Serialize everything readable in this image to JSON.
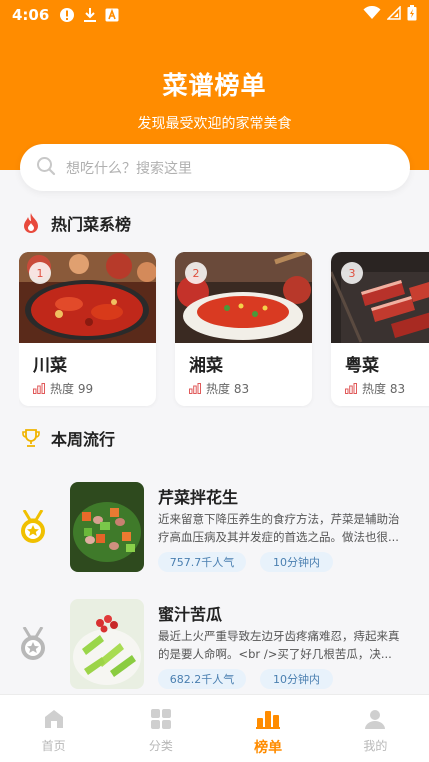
{
  "status_bar": {
    "time": "4:06"
  },
  "header": {
    "title": "菜谱榜单",
    "subtitle": "发现最受欢迎的家常美食",
    "background_color": "#ff8c00"
  },
  "search": {
    "placeholder": "想吃什么？搜索这里",
    "icon": "search-icon"
  },
  "hot_section": {
    "title": "热门菜系榜",
    "icon": "fire-icon",
    "cards": [
      {
        "rank": "1",
        "name": "川菜",
        "heat": "热度 99"
      },
      {
        "rank": "2",
        "name": "湘菜",
        "heat": "热度 83"
      },
      {
        "rank": "3",
        "name": "粤菜",
        "heat": "热度 83"
      }
    ]
  },
  "weekly_section": {
    "title": "本周流行",
    "icon": "trophy-icon",
    "items": [
      {
        "medal": "gold-medal-icon",
        "title": "芹菜拌花生",
        "description": "近来留意下降压养生的食疗方法，芹菜是辅助治疗高血压病及其并发症的首选之品。做法也很...",
        "popularity": "757.7千人气",
        "time": "10分钟内"
      },
      {
        "medal": "silver-medal-icon",
        "title": "蜜汁苦瓜",
        "description": "最近上火严重导致左边牙齿疼痛难忍，痔起来真的是要人命啊。<br />买了好几根苦瓜，决...",
        "popularity": "682.2千人气",
        "time": "10分钟内"
      }
    ]
  },
  "tabbar": {
    "items": [
      {
        "label": "首页",
        "icon": "home-icon"
      },
      {
        "label": "分类",
        "icon": "grid-icon"
      },
      {
        "label": "榜单",
        "icon": "ranking-icon",
        "active": true
      },
      {
        "label": "我的",
        "icon": "user-icon"
      }
    ],
    "active_color": "#ff8c00"
  }
}
